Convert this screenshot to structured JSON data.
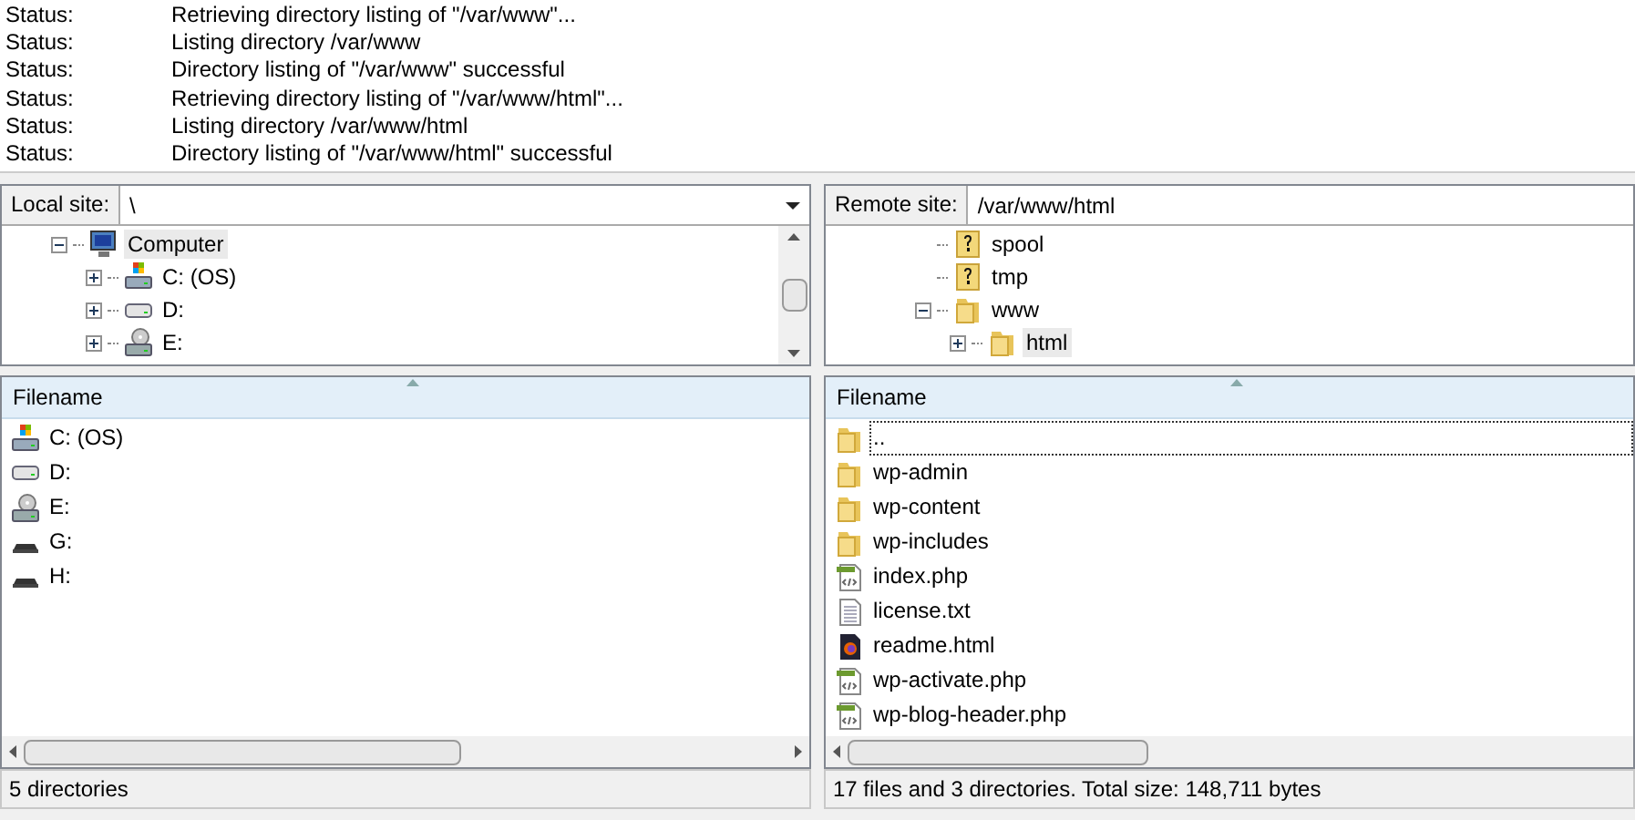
{
  "message_log": [
    {
      "label": "Status:",
      "message": "Retrieving directory listing of \"/var/www\"..."
    },
    {
      "label": "Status:",
      "message": "Listing directory /var/www"
    },
    {
      "label": "Status:",
      "message": "Directory listing of \"/var/www\" successful"
    },
    {
      "label": "Status:",
      "message": "Retrieving directory listing of \"/var/www/html\"..."
    },
    {
      "label": "Status:",
      "message": "Listing directory /var/www/html"
    },
    {
      "label": "Status:",
      "message": "Directory listing of \"/var/www/html\" successful"
    }
  ],
  "panes": [
    {
      "site_label": "Local site:",
      "path": "\\",
      "has_dropdown": true,
      "tree_scrollbar": true,
      "tree": [
        {
          "label": "Computer",
          "kind": "computer",
          "expandable": true,
          "expanded": true,
          "selected": true,
          "children": [
            {
              "label": "C: (OS)",
              "kind": "drive-os",
              "expandable": true,
              "expanded": false,
              "selected": false
            },
            {
              "label": "D:",
              "kind": "drive",
              "expandable": true,
              "expanded": false,
              "selected": false
            },
            {
              "label": "E:",
              "kind": "drive-cd",
              "expandable": true,
              "expanded": false,
              "selected": false
            }
          ]
        }
      ],
      "column": "Filename",
      "files": [
        {
          "name": "C: (OS)",
          "kind": "drive-os",
          "focused": false
        },
        {
          "name": "D:",
          "kind": "drive",
          "focused": false
        },
        {
          "name": "E:",
          "kind": "drive-cd",
          "focused": false
        },
        {
          "name": "G:",
          "kind": "drive-removable",
          "focused": false
        },
        {
          "name": "H:",
          "kind": "drive-removable",
          "focused": false
        }
      ],
      "status": "5 directories"
    },
    {
      "site_label": "Remote site:",
      "path": "/var/www/html",
      "has_dropdown": false,
      "tree_scrollbar": false,
      "tree": [
        {
          "label": "spool",
          "kind": "folder-unknown",
          "expandable": false,
          "selected": false
        },
        {
          "label": "tmp",
          "kind": "folder-unknown",
          "expandable": false,
          "selected": false
        },
        {
          "label": "www",
          "kind": "folder",
          "expandable": true,
          "expanded": true,
          "selected": false,
          "children": [
            {
              "label": "html",
              "kind": "folder",
              "expandable": true,
              "expanded": false,
              "selected": true
            }
          ]
        }
      ],
      "column": "Filename",
      "files": [
        {
          "name": "..",
          "kind": "folder",
          "focused": true
        },
        {
          "name": "wp-admin",
          "kind": "folder",
          "focused": false
        },
        {
          "name": "wp-content",
          "kind": "folder",
          "focused": false
        },
        {
          "name": "wp-includes",
          "kind": "folder",
          "focused": false
        },
        {
          "name": "index.php",
          "kind": "php",
          "focused": false
        },
        {
          "name": "license.txt",
          "kind": "txt",
          "focused": false
        },
        {
          "name": "readme.html",
          "kind": "html",
          "focused": false
        },
        {
          "name": "wp-activate.php",
          "kind": "php",
          "focused": false
        },
        {
          "name": "wp-blog-header.php",
          "kind": "php",
          "focused": false
        }
      ],
      "status": "17 files and 3 directories. Total size: 148,711 bytes"
    }
  ]
}
